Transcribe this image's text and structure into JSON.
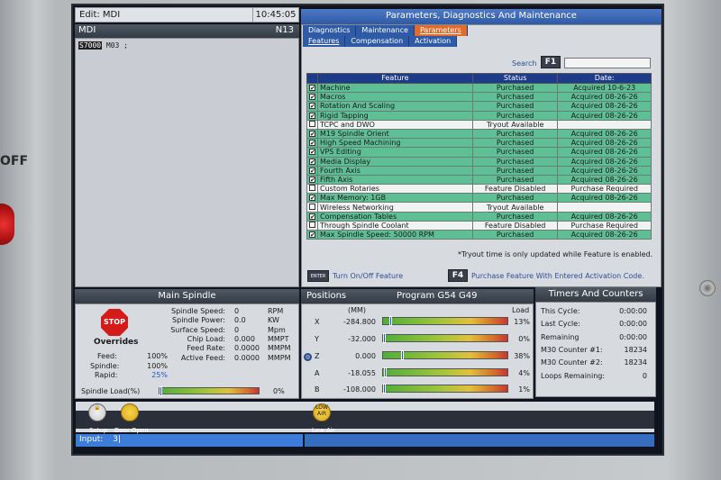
{
  "edit": {
    "title": "Edit: MDI",
    "clock": "10:45:05"
  },
  "mdi": {
    "title": "MDI",
    "line_no": "N13",
    "program_highlight": "S7000",
    "program_rest": " M03 ;"
  },
  "params": {
    "title": "Parameters, Diagnostics And Maintenance",
    "tabs_top": [
      "Diagnostics",
      "Maintenance",
      "Parameters"
    ],
    "tabs_sub": [
      "Features",
      "Compensation",
      "Activation"
    ],
    "search_label": "Search",
    "search_key": "F1",
    "columns": [
      "Feature",
      "Status",
      "Date:"
    ],
    "rows": [
      {
        "checked": true,
        "feature": "Machine",
        "status": "Purchased",
        "date": "Acquired 10-6-23"
      },
      {
        "checked": true,
        "feature": "Macros",
        "status": "Purchased",
        "date": "Acquired 08-26-26"
      },
      {
        "checked": true,
        "feature": "Rotation And Scaling",
        "status": "Purchased",
        "date": "Acquired 08-26-26"
      },
      {
        "checked": true,
        "feature": "Rigid Tapping",
        "status": "Purchased",
        "date": "Acquired 08-26-26"
      },
      {
        "checked": false,
        "feature": "TCPC and DWO",
        "status": "Tryout Available",
        "date": ""
      },
      {
        "checked": true,
        "feature": "M19 Spindle Orient",
        "status": "Purchased",
        "date": "Acquired 08-26-26"
      },
      {
        "checked": true,
        "feature": "High Speed Machining",
        "status": "Purchased",
        "date": "Acquired 08-26-26"
      },
      {
        "checked": true,
        "feature": "VPS Editing",
        "status": "Purchased",
        "date": "Acquired 08-26-26"
      },
      {
        "checked": true,
        "feature": "Media Display",
        "status": "Purchased",
        "date": "Acquired 08-26-26"
      },
      {
        "checked": true,
        "feature": "Fourth Axis",
        "status": "Purchased",
        "date": "Acquired 08-26-26"
      },
      {
        "checked": true,
        "feature": "Fifth Axis",
        "status": "Purchased",
        "date": "Acquired 08-26-26"
      },
      {
        "checked": false,
        "feature": "Custom Rotaries",
        "status": "Feature Disabled",
        "date": "Purchase Required"
      },
      {
        "checked": true,
        "feature": "Max Memory: 1GB",
        "status": "Purchased",
        "date": "Acquired 08-26-26"
      },
      {
        "checked": false,
        "feature": "Wireless Networking",
        "status": "Tryout Available",
        "date": ""
      },
      {
        "checked": true,
        "feature": "Compensation Tables",
        "status": "Purchased",
        "date": "Acquired 08-26-26"
      },
      {
        "checked": false,
        "feature": "Through Spindle Coolant",
        "status": "Feature Disabled",
        "date": "Purchase Required"
      },
      {
        "checked": true,
        "feature": "Max Spindle Speed: 50000 RPM",
        "status": "Purchased",
        "date": "Acquired 08-26-26"
      }
    ],
    "tryout_note": "*Tryout time is only updated while Feature is enabled.",
    "enter_key": "ENTER",
    "enter_label": "Turn On/Off Feature",
    "f4_key": "F4",
    "f4_label": "Purchase Feature With Entered Activation Code."
  },
  "spindle": {
    "title": "Main Spindle",
    "stop_label": "STOP",
    "overrides_title": "Overrides",
    "overrides": [
      {
        "label": "Feed:",
        "value": "100%"
      },
      {
        "label": "Spindle:",
        "value": "100%"
      },
      {
        "label": "Rapid:",
        "value": "25%"
      }
    ],
    "rows": [
      {
        "label": "Spindle Speed:",
        "value": "0",
        "unit": "RPM"
      },
      {
        "label": "Spindle Power:",
        "value": "0.0",
        "unit": "KW"
      },
      {
        "label": "Surface Speed:",
        "value": "0",
        "unit": "Mpm"
      },
      {
        "label": "Chip Load:",
        "value": "0.000",
        "unit": "MMPT"
      },
      {
        "label": "Feed Rate:",
        "value": "0.0000",
        "unit": "MMPM"
      },
      {
        "label": "Active Feed:",
        "value": "0.0000",
        "unit": "MMPM"
      }
    ],
    "load_label": "Spindle Load(%)",
    "load_value": "0%",
    "load_fraction": 0.0
  },
  "positions": {
    "title": "Positions",
    "program": "Program G54 G49",
    "unit_col": "(MM)",
    "load_col": "Load",
    "axes": [
      {
        "axis": "X",
        "value": "-284.800",
        "load": "13%",
        "marker": 0.05
      },
      {
        "axis": "Y",
        "value": "-32.000",
        "load": "0%",
        "marker": 0.0
      },
      {
        "axis": "Z",
        "value": "0.000",
        "load": "38%",
        "marker": 0.15
      },
      {
        "axis": "A",
        "value": "-18.055",
        "load": "4%",
        "marker": 0.01
      },
      {
        "axis": "B",
        "value": "-108.000",
        "load": "1%",
        "marker": 0.0
      }
    ]
  },
  "timers": {
    "title": "Timers And Counters",
    "rows": [
      {
        "label": "This Cycle:",
        "value": "0:00:00"
      },
      {
        "label": "Last Cycle:",
        "value": "0:00:00"
      },
      {
        "label": "Remaining",
        "value": "0:00:00"
      },
      {
        "label": "M30 Counter #1:",
        "value": "18234"
      },
      {
        "label": "M30 Counter #2:",
        "value": "18234"
      },
      {
        "label": "Loops Remaining:",
        "value": "0"
      }
    ]
  },
  "status": {
    "setup_label": "Setup",
    "door_label": "Door Open",
    "lowair_label": "Low Air",
    "lowair_icon_text": "LOW AIR"
  },
  "input": {
    "label": "Input:",
    "value": "3|"
  },
  "bezel": {
    "off_label": "OFF"
  }
}
